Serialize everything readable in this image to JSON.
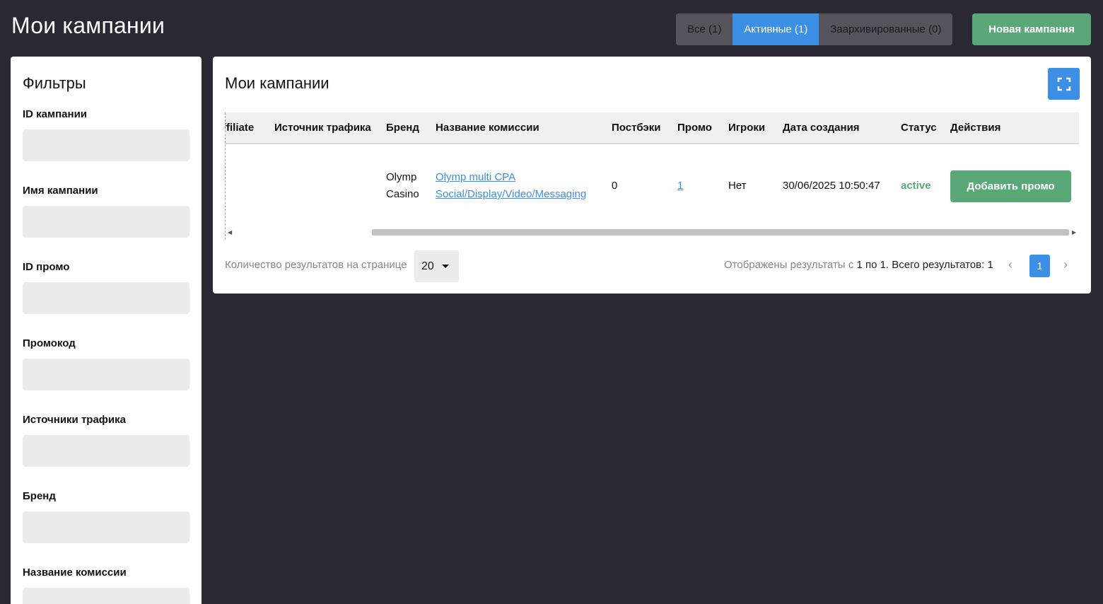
{
  "header": {
    "title": "Мои кампании",
    "tabs": [
      {
        "label": "Все (1)"
      },
      {
        "label": "Активные (1)"
      },
      {
        "label": "Заархивированные (0)"
      }
    ],
    "new_campaign_label": "Новая кампания"
  },
  "filters": {
    "title": "Фильтры",
    "fields": [
      {
        "label": "ID кампании"
      },
      {
        "label": "Имя кампании"
      },
      {
        "label": "ID промо"
      },
      {
        "label": "Промокод"
      },
      {
        "label": "Источники трафика"
      },
      {
        "label": "Бренд"
      },
      {
        "label": "Название комиссии"
      }
    ]
  },
  "panel": {
    "title": "Мои кампании",
    "columns": [
      "ffiliate",
      "Источник трафика",
      "Бренд",
      "Название комиссии",
      "Постбэки",
      "Промо",
      "Игроки",
      "Дата создания",
      "Статус",
      "Действия"
    ],
    "row": {
      "brand_line1": "Olymp",
      "brand_line2": "Casino",
      "commission_line1": "Olymp multi CPA",
      "commission_line2": "Social/Display/Video/Messaging",
      "postbacks": "0",
      "promo": "1",
      "players": "Нет",
      "created": "30/06/2025 10:50:47",
      "status": "active",
      "action_label": "Добавить промо"
    },
    "per_page_label": "Количество результатов на странице",
    "per_page_value": "20",
    "results_prefix": "Отображены результаты с",
    "results_highlight": "1 по 1. Всего результатов: 1",
    "current_page": "1"
  },
  "colors": {
    "background": "#2a2933",
    "accent_blue": "#3d8fe6",
    "accent_green": "#5aa878"
  }
}
